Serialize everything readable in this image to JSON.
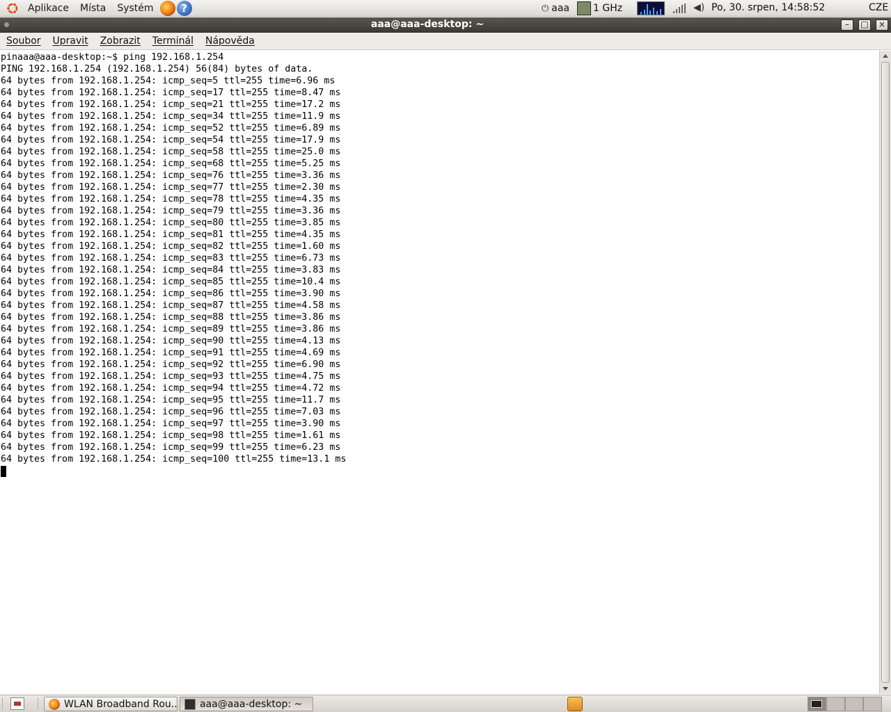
{
  "top_panel": {
    "menus": [
      "Aplikace",
      "Místa",
      "Systém"
    ],
    "help_glyph": "?",
    "user": "aaa",
    "cpu_freq": "1 GHz",
    "clock": "Po, 30. srpen, 14:58:52",
    "keyboard_layout": "CZE"
  },
  "window": {
    "title": "aaa@aaa-desktop: ~",
    "minimize_glyph": "–",
    "maximize_glyph": "□",
    "close_glyph": "×"
  },
  "menubar": {
    "items": [
      "Soubor",
      "Upravit",
      "Zobrazit",
      "Terminál",
      "Nápověda"
    ]
  },
  "terminal": {
    "lines": [
      "pinaaa@aaa-desktop:~$ ping 192.168.1.254",
      "PING 192.168.1.254 (192.168.1.254) 56(84) bytes of data.",
      "64 bytes from 192.168.1.254: icmp_seq=5 ttl=255 time=6.96 ms",
      "64 bytes from 192.168.1.254: icmp_seq=17 ttl=255 time=8.47 ms",
      "64 bytes from 192.168.1.254: icmp_seq=21 ttl=255 time=17.2 ms",
      "64 bytes from 192.168.1.254: icmp_seq=34 ttl=255 time=11.9 ms",
      "64 bytes from 192.168.1.254: icmp_seq=52 ttl=255 time=6.89 ms",
      "64 bytes from 192.168.1.254: icmp_seq=54 ttl=255 time=17.9 ms",
      "64 bytes from 192.168.1.254: icmp_seq=58 ttl=255 time=25.0 ms",
      "64 bytes from 192.168.1.254: icmp_seq=68 ttl=255 time=5.25 ms",
      "64 bytes from 192.168.1.254: icmp_seq=76 ttl=255 time=3.36 ms",
      "64 bytes from 192.168.1.254: icmp_seq=77 ttl=255 time=2.30 ms",
      "64 bytes from 192.168.1.254: icmp_seq=78 ttl=255 time=4.35 ms",
      "64 bytes from 192.168.1.254: icmp_seq=79 ttl=255 time=3.36 ms",
      "64 bytes from 192.168.1.254: icmp_seq=80 ttl=255 time=3.85 ms",
      "64 bytes from 192.168.1.254: icmp_seq=81 ttl=255 time=4.35 ms",
      "64 bytes from 192.168.1.254: icmp_seq=82 ttl=255 time=1.60 ms",
      "64 bytes from 192.168.1.254: icmp_seq=83 ttl=255 time=6.73 ms",
      "64 bytes from 192.168.1.254: icmp_seq=84 ttl=255 time=3.83 ms",
      "64 bytes from 192.168.1.254: icmp_seq=85 ttl=255 time=10.4 ms",
      "64 bytes from 192.168.1.254: icmp_seq=86 ttl=255 time=3.90 ms",
      "64 bytes from 192.168.1.254: icmp_seq=87 ttl=255 time=4.58 ms",
      "64 bytes from 192.168.1.254: icmp_seq=88 ttl=255 time=3.86 ms",
      "64 bytes from 192.168.1.254: icmp_seq=89 ttl=255 time=3.86 ms",
      "64 bytes from 192.168.1.254: icmp_seq=90 ttl=255 time=4.13 ms",
      "64 bytes from 192.168.1.254: icmp_seq=91 ttl=255 time=4.69 ms",
      "64 bytes from 192.168.1.254: icmp_seq=92 ttl=255 time=6.90 ms",
      "64 bytes from 192.168.1.254: icmp_seq=93 ttl=255 time=4.75 ms",
      "64 bytes from 192.168.1.254: icmp_seq=94 ttl=255 time=4.72 ms",
      "64 bytes from 192.168.1.254: icmp_seq=95 ttl=255 time=11.7 ms",
      "64 bytes from 192.168.1.254: icmp_seq=96 ttl=255 time=7.03 ms",
      "64 bytes from 192.168.1.254: icmp_seq=97 ttl=255 time=3.90 ms",
      "64 bytes from 192.168.1.254: icmp_seq=98 ttl=255 time=1.61 ms",
      "64 bytes from 192.168.1.254: icmp_seq=99 ttl=255 time=6.23 ms",
      "64 bytes from 192.168.1.254: icmp_seq=100 ttl=255 time=13.1 ms"
    ]
  },
  "taskbar": {
    "tasks": [
      {
        "label": "WLAN Broadband Rou...",
        "icon": "firefox-icon",
        "active": false
      },
      {
        "label": "aaa@aaa-desktop: ~",
        "icon": "terminal-icon",
        "active": true
      }
    ],
    "workspaces": 4
  },
  "icons": {
    "distro_logo": "ubuntu-logo-icon",
    "browser_launcher": "firefox-icon",
    "help_launcher": "help-icon",
    "power": "power-icon",
    "cpu": "cpu-frequency-icon",
    "system_monitor": "system-monitor-icon",
    "network": "network-signal-icon",
    "volume": "volume-icon",
    "trash": "trash-icon"
  },
  "colors": {
    "panel_bg": "#dcd9d4",
    "titlebar_bg": "#3d3a35",
    "terminal_bg": "#ffffff",
    "terminal_fg": "#000000",
    "ubuntu_orange": "#dd4814"
  }
}
